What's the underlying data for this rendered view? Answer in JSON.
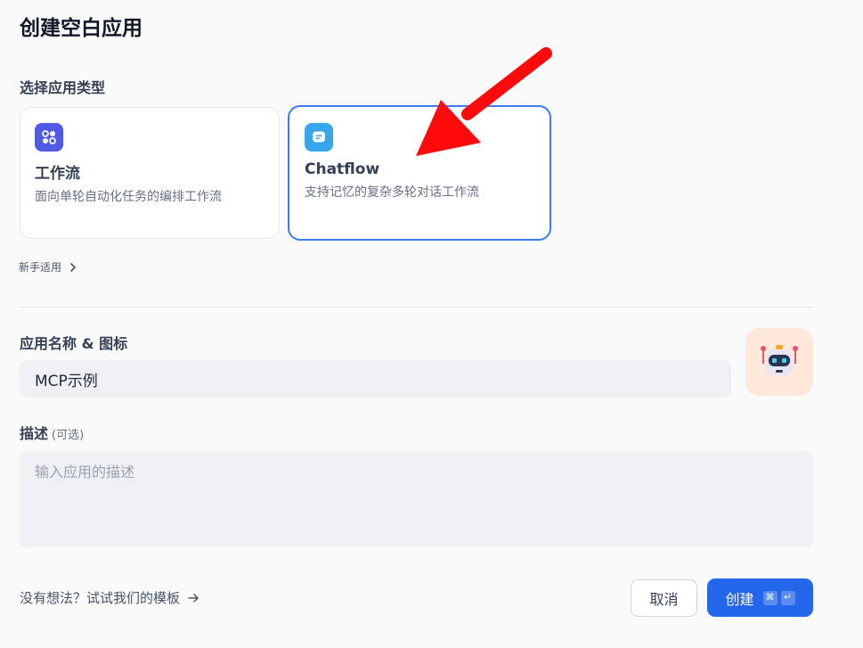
{
  "page": {
    "title": "创建空白应用"
  },
  "app_type": {
    "label": "选择应用类型",
    "options": [
      {
        "title": "工作流",
        "description": "面向单轮自动化任务的编排工作流",
        "icon": "workflow-icon",
        "selected": false
      },
      {
        "title": "Chatflow",
        "description": "支持记忆的复杂多轮对话工作流",
        "icon": "chatflow-icon",
        "selected": true
      }
    ],
    "beginner_link": "新手适用"
  },
  "name_section": {
    "label": "应用名称 & 图标",
    "value": "MCP示例",
    "avatar_icon": "robot-icon"
  },
  "description_section": {
    "label": "描述",
    "optional": "(可选)",
    "placeholder": "输入应用的描述"
  },
  "footer": {
    "template_link": "没有想法？试试我们的模板",
    "cancel_label": "取消",
    "create_label": "创建",
    "shortcut_keys": [
      "⌘",
      "↵"
    ]
  },
  "colors": {
    "primary": "#2467ec",
    "selected_border": "#3b7cf6",
    "workflow_icon_bg": "#4f5ae6",
    "chatflow_icon_bg": "#38a6ec",
    "annotation_arrow": "#ff0a0a"
  }
}
